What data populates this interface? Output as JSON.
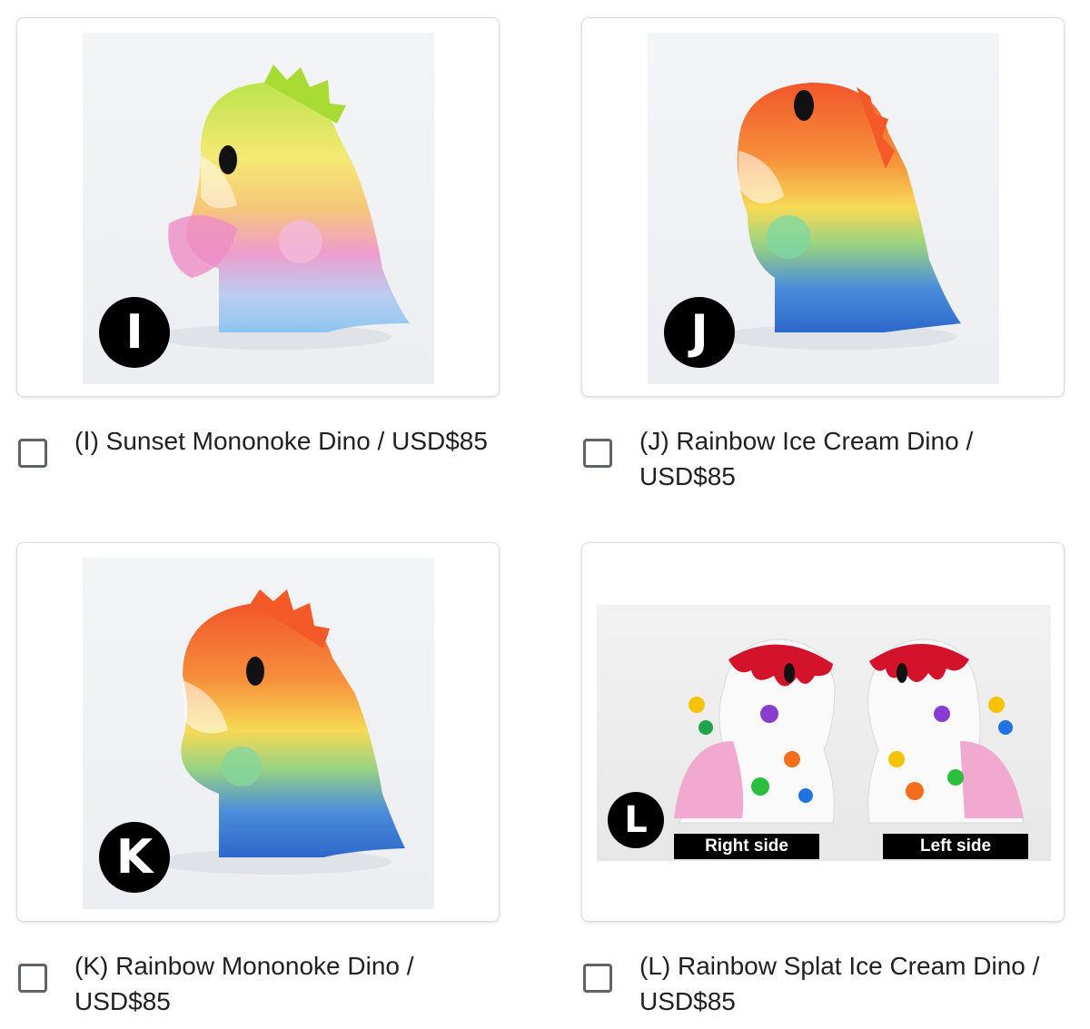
{
  "items": [
    {
      "badge": "I",
      "label": "(Ⅰ) Sunset Mononoke Dino / USD$85",
      "colors": [
        "#b7e23d",
        "#f5e86a",
        "#f7c46f",
        "#ee96c9",
        "#b7c9f0",
        "#86c3f0"
      ]
    },
    {
      "badge": "J",
      "label": "(J) Rainbow Ice Cream Dino / USD$85",
      "colors": [
        "#f24a1c",
        "#f6882d",
        "#f7d84a",
        "#93d07a",
        "#3f86d8",
        "#1f5fc8"
      ]
    },
    {
      "badge": "K",
      "label": "(K) Rainbow Mononoke Dino / USD$85",
      "colors": [
        "#f24a1c",
        "#f6882d",
        "#f7d84a",
        "#93d07a",
        "#3f86d8",
        "#1f5fc8"
      ]
    },
    {
      "badge": "L",
      "label": "(L) Rainbow Splat Ice Cream Dino / USD$85",
      "right_side": "Right side",
      "left_side": "Left side"
    }
  ]
}
